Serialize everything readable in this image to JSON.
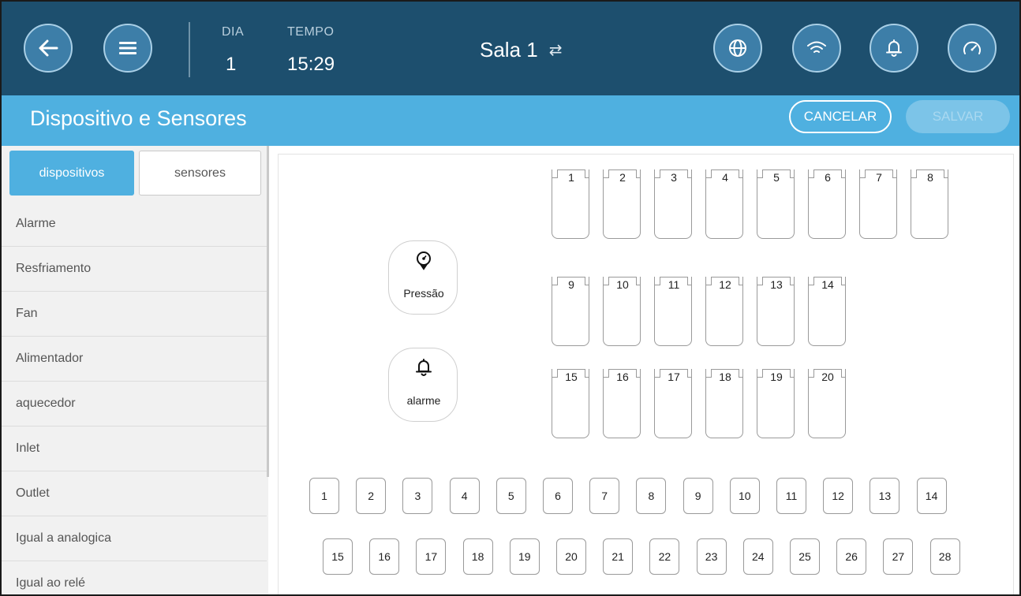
{
  "header": {
    "back_icon": "back-arrow-icon",
    "menu_icon": "hamburger-menu-icon",
    "day_label": "DIA",
    "day_value": "1",
    "time_label": "TEMPO",
    "time_value": "15:29",
    "room": "Sala 1",
    "room_switch_icon": "swap-arrows-icon",
    "right_icons": [
      "globe-icon",
      "wifi-icon",
      "bell-icon",
      "gauge-icon"
    ]
  },
  "titlebar": {
    "title": "Dispositivo e Sensores",
    "cancel_label": "CANCELAR",
    "save_label": "SALVAR"
  },
  "tabs": {
    "devices": "dispositivos",
    "sensors": "sensores"
  },
  "sidebar": {
    "items": [
      "Alarme",
      "Resfriamento",
      "Fan",
      "Alimentador",
      "aquecedor",
      "Inlet",
      "Outlet",
      "Igual a analogica",
      "Igual ao relé"
    ]
  },
  "devices": {
    "pressure_label": "Pressão",
    "pressure_icon": "pressure-bulb-icon",
    "alarm_label": "alarme",
    "alarm_icon": "bell-icon"
  },
  "relays": {
    "row1": [
      "1",
      "2",
      "3",
      "4",
      "5",
      "6",
      "7",
      "8"
    ],
    "row2": [
      "9",
      "10",
      "11",
      "12",
      "13",
      "14"
    ],
    "row3": [
      "15",
      "16",
      "17",
      "18",
      "19",
      "20"
    ]
  },
  "ports": {
    "row1": [
      "1",
      "2",
      "3",
      "4",
      "5",
      "6",
      "7",
      "8",
      "9",
      "10",
      "11",
      "12",
      "13",
      "14"
    ],
    "row2": [
      "15",
      "16",
      "17",
      "18",
      "19",
      "20",
      "21",
      "22",
      "23",
      "24",
      "25",
      "26",
      "27",
      "28"
    ]
  },
  "colors": {
    "header_bg": "#1d4f6e",
    "titlebar_bg": "#4fb0e0",
    "accent": "#4fb0e0",
    "circle_btn": "#3d7ea8"
  }
}
